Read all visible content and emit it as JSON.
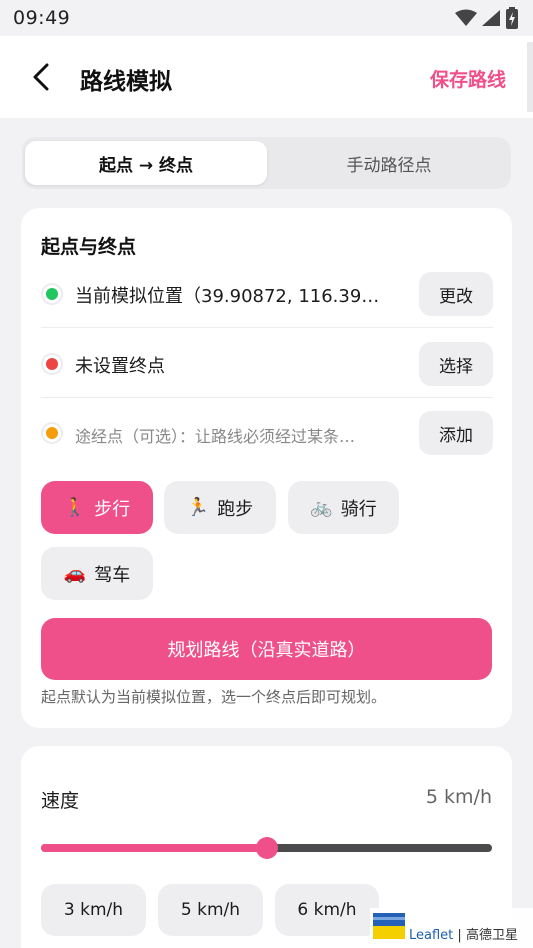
{
  "status_bar": {
    "time": "09:49"
  },
  "header": {
    "title": "路线模拟",
    "save_label": "保存路线"
  },
  "tabs": [
    {
      "label": "起点 → 终点",
      "active": true
    },
    {
      "label": "手动路径点",
      "active": false
    }
  ],
  "route_card": {
    "title": "起点与终点",
    "rows": [
      {
        "dot_color": "#22c55e",
        "text": "当前模拟位置（39.90872, 116.39…",
        "button": "更改"
      },
      {
        "dot_color": "#ef4444",
        "text": "未设置终点",
        "button": "选择"
      },
      {
        "dot_color": "#f59e0b",
        "text": "途经点（可选）：让路线必须经过某条…",
        "button": "添加"
      }
    ],
    "modes": [
      {
        "emoji": "🚶",
        "label": "步行",
        "active": true
      },
      {
        "emoji": "🏃",
        "label": "跑步",
        "active": false
      },
      {
        "emoji": "🚲",
        "label": "骑行",
        "active": false
      },
      {
        "emoji": "🚗",
        "label": "驾车",
        "active": false
      }
    ],
    "plan_button": "规划路线（沿真实道路）",
    "hint": "起点默认为当前模拟位置，选一个终点后即可规划。"
  },
  "speed_card": {
    "label": "速度",
    "value": "5 km/h",
    "slider_fraction": 0.5,
    "presets": [
      "3 km/h",
      "5 km/h",
      "6 km/h"
    ]
  },
  "attribution": {
    "leaflet": "Leaflet",
    "separator": "|",
    "provider": "高德卫星"
  },
  "colors": {
    "accent": "#f0508a",
    "start": "#22c55e",
    "end": "#ef4444",
    "waypoint": "#f59e0b"
  }
}
